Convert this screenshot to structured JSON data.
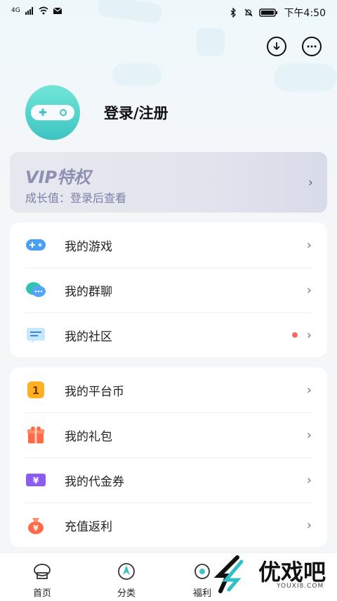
{
  "status_bar": {
    "time": "下午4:50",
    "network": "4G"
  },
  "header": {
    "download_icon": "download-icon",
    "message_icon": "chat-icon"
  },
  "profile": {
    "login_text": "登录/注册"
  },
  "vip": {
    "title": "VIP特权",
    "subtitle": "成长值：登录后查看",
    "arrow": "›"
  },
  "menu_group_1": [
    {
      "label": "我的游戏",
      "icon": "gamepad-icon",
      "has_dot": false
    },
    {
      "label": "我的群聊",
      "icon": "group-chat-icon",
      "has_dot": false
    },
    {
      "label": "我的社区",
      "icon": "community-icon",
      "has_dot": true
    }
  ],
  "menu_group_2": [
    {
      "label": "我的平台币",
      "icon": "coin-icon"
    },
    {
      "label": "我的礼包",
      "icon": "gift-icon"
    },
    {
      "label": "我的代金券",
      "icon": "voucher-icon"
    },
    {
      "label": "充值返利",
      "icon": "money-bag-icon"
    }
  ],
  "tabbar": {
    "tabs": [
      {
        "label": "首页",
        "icon": "home-icon"
      },
      {
        "label": "分类",
        "icon": "category-icon"
      },
      {
        "label": "福利",
        "icon": "welfare-icon"
      }
    ]
  },
  "watermark": {
    "text": "优戏吧",
    "sub": "YOUXI8.COM"
  },
  "colors": {
    "accent_teal": "#3ec3c3",
    "vip_text": "#8e8fb3",
    "dot": "#ff6a6a"
  }
}
